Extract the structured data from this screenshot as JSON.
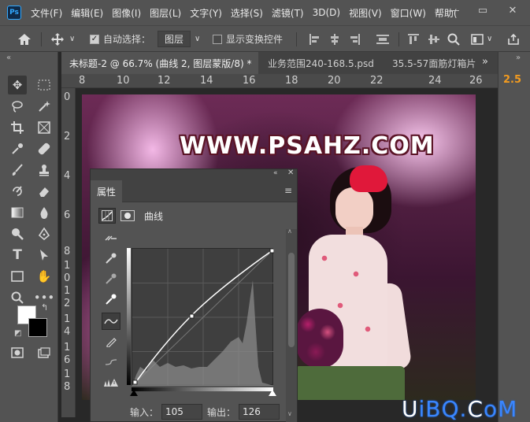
{
  "menubar": {
    "items": [
      "文件(F)",
      "编辑(E)",
      "图像(I)",
      "图层(L)",
      "文字(Y)",
      "选择(S)",
      "滤镜(T)",
      "3D(D)",
      "视图(V)",
      "窗口(W)",
      "帮助("
    ]
  },
  "optionsbar": {
    "auto_select_label": "自动选择：",
    "auto_select_target": "图层",
    "show_transform_label": "显示变换控件"
  },
  "tabs": [
    {
      "label": "未标题-2 @ 66.7% (曲线 2, 图层蒙版/8) *",
      "active": true
    },
    {
      "label": "业务范围240-168.5.psd",
      "active": false
    },
    {
      "label": "35.5-57面筋灯箱片",
      "active": false
    }
  ],
  "ruler_top": [
    "8",
    "10",
    "12",
    "14",
    "16",
    "18",
    "20",
    "22",
    "24",
    "26"
  ],
  "ruler_left": [
    "0",
    "2",
    "4",
    "6",
    "8",
    "1",
    "0",
    "1",
    "2",
    "1",
    "4",
    "1",
    "6",
    "1",
    "8"
  ],
  "canvas": {
    "watermark": "WWW.PSAHZ.COM"
  },
  "properties": {
    "tab_label": "属性",
    "adjustment_name": "曲线",
    "input_label": "输入：",
    "input_value": "105",
    "output_label": "输出：",
    "output_value": "126"
  },
  "right_panel": {
    "zoom_value": "2.5"
  },
  "site_watermark": {
    "part1": "U",
    "part2": "iBQ.",
    "part3": "C",
    "part4": "oM"
  },
  "colors": {
    "ui_bg": "#535353",
    "accent_orange": "#f29b1f",
    "ps_blue": "#31a8ff"
  },
  "icons": [
    "home-icon",
    "move-icon",
    "search-icon",
    "workspace-icon",
    "share-icon"
  ]
}
